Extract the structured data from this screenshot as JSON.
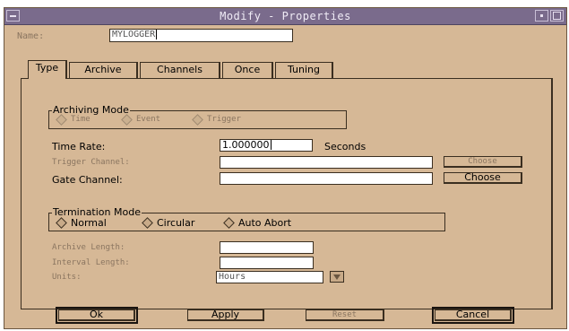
{
  "window": {
    "title": "Modify - Properties"
  },
  "name_row": {
    "label": "Name:",
    "value": "MYLOGGER"
  },
  "tabs": [
    {
      "label": "Type"
    },
    {
      "label": "Archive"
    },
    {
      "label": "Channels"
    },
    {
      "label": "Once"
    },
    {
      "label": "Tuning"
    }
  ],
  "archiving_mode": {
    "title": "Archiving Mode",
    "options": [
      "Time",
      "Event",
      "Trigger"
    ]
  },
  "time_rate": {
    "label": "Time Rate:",
    "value": "1.000000",
    "unit": "Seconds"
  },
  "trigger_channel": {
    "label": "Trigger Channel:",
    "value": "",
    "button": "Choose"
  },
  "gate_channel": {
    "label": "Gate Channel:",
    "value": "",
    "button": "Choose"
  },
  "termination_mode": {
    "title": "Termination Mode",
    "options": [
      "Normal",
      "Circular",
      "Auto Abort"
    ]
  },
  "archive_length": {
    "label": "Archive Length:",
    "value": ""
  },
  "interval_length": {
    "label": "Interval Length:",
    "value": ""
  },
  "units": {
    "label": "Units:",
    "value": "Hours"
  },
  "buttons": {
    "ok": "Ok",
    "apply": "Apply",
    "reset": "Reset",
    "cancel": "Cancel"
  },
  "colors": {
    "background": "#d6b896",
    "titlebar": "#7a6b8c",
    "field": "#ffffff"
  }
}
